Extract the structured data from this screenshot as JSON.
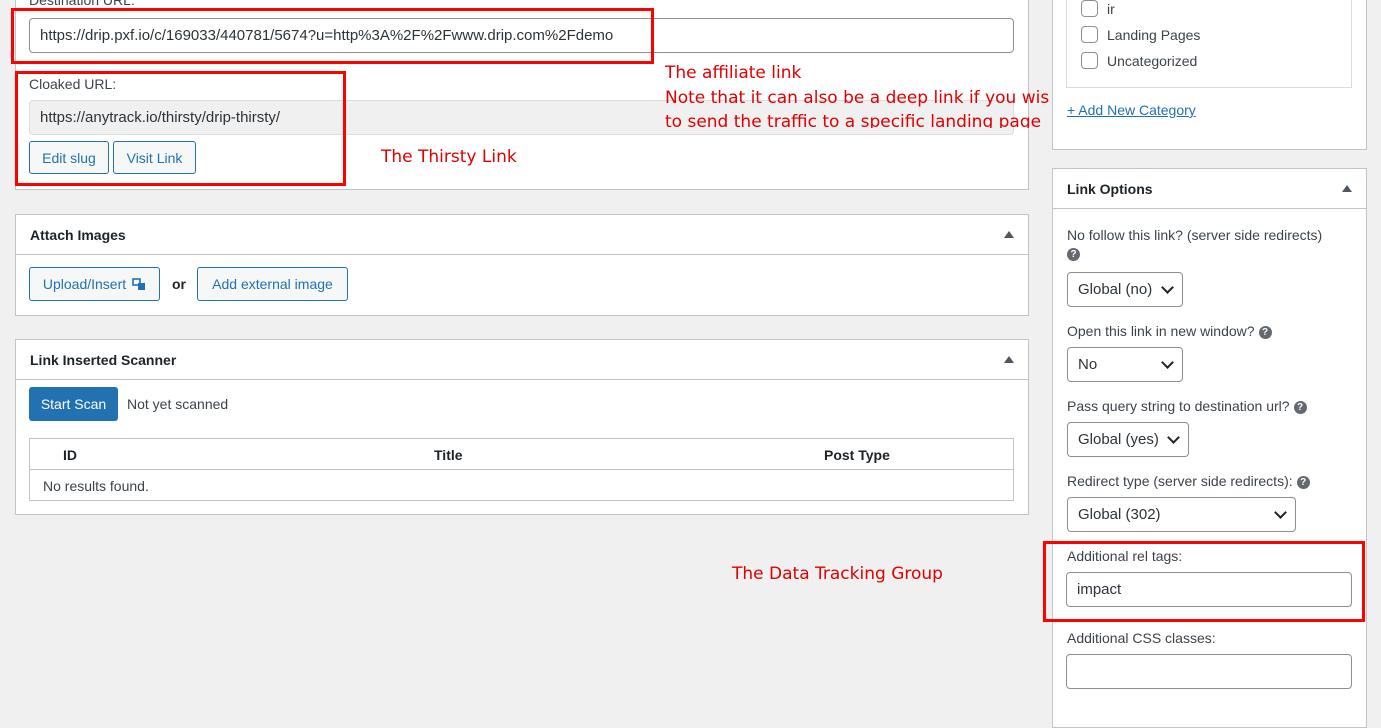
{
  "link_url": {
    "destination_label": "Destination URL:",
    "destination_value": "https://drip.pxf.io/c/169033/440781/5674?u=http%3A%2F%2Fwww.drip.com%2Fdemo",
    "cloaked_label": "Cloaked URL:",
    "cloaked_value": "https://anytrack.io/thirsty/drip-thirsty/",
    "edit_slug": "Edit slug",
    "visit_link": "Visit Link"
  },
  "attach_images": {
    "title": "Attach Images",
    "upload": "Upload/Insert",
    "or": "or",
    "external": "Add external image"
  },
  "scanner": {
    "title": "Link Inserted Scanner",
    "start": "Start Scan",
    "status": "Not yet scanned",
    "columns": [
      "ID",
      "Title",
      "Post Type"
    ],
    "empty": "No results found."
  },
  "categories": {
    "items": [
      "ir",
      "Landing Pages",
      "Uncategorized"
    ],
    "add_new": "+ Add New Category"
  },
  "link_options": {
    "title": "Link Options",
    "nofollow_label": "No follow this link? (server side redirects)",
    "nofollow_value": "Global (no)",
    "new_window_label": "Open this link in new window?",
    "new_window_value": "No",
    "pass_query_label": "Pass query string to destination url?",
    "pass_query_value": "Global (yes)",
    "redirect_label": "Redirect type (server side redirects):",
    "redirect_value": "Global (302)",
    "rel_label": "Additional rel tags:",
    "rel_value": "impact",
    "css_label": "Additional CSS classes:",
    "css_value": ""
  },
  "annotations": {
    "affiliate_title": "The affiliate link",
    "affiliate_note1": "Note that it can also be a deep link if you wis",
    "affiliate_note2": "to send the traffic to a specific landing page",
    "thirsty": "The Thirsty Link",
    "tracking": "The Data Tracking Group"
  },
  "colors": {
    "accent": "#2271b1",
    "annotation_red": "#ff0000",
    "background": "#f0f0f1"
  }
}
